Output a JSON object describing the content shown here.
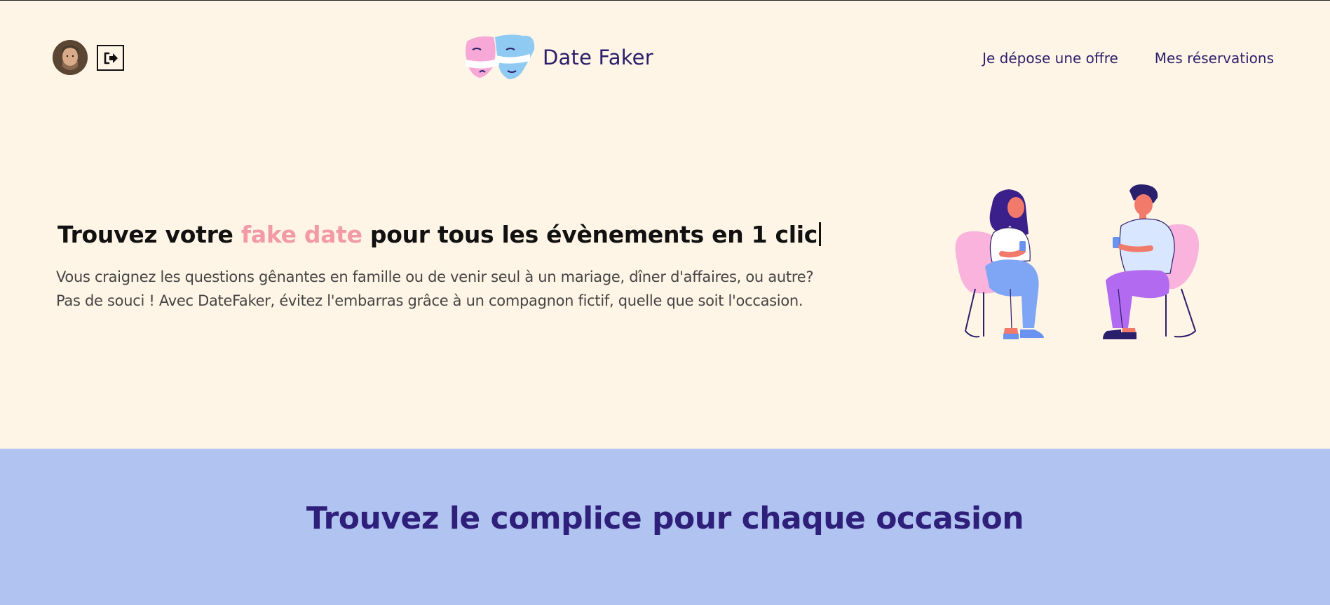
{
  "header": {
    "brand_name": "Date Faker",
    "nav": [
      {
        "label": "Je dépose une offre"
      },
      {
        "label": "Mes réservations"
      }
    ]
  },
  "hero": {
    "title_part1": "Trouvez votre ",
    "title_accent": "fake date",
    "title_part2": " pour tous les évènements en 1 clic",
    "description_line1": "Vous craignez les questions gênantes en famille ou de venir seul à un mariage, dîner d'affaires, ou autre?",
    "description_line2": "Pas de souci ! Avec DateFaker, évitez l'embarras grâce à un compagnon fictif, quelle que soit l'occasion."
  },
  "occasions": {
    "title": "Trouvez le complice pour chaque occasion"
  },
  "colors": {
    "background": "#fff5e6",
    "accent_pink": "#f29aa8",
    "navy": "#2a1f6b",
    "section_blue": "#b1c3f0"
  }
}
